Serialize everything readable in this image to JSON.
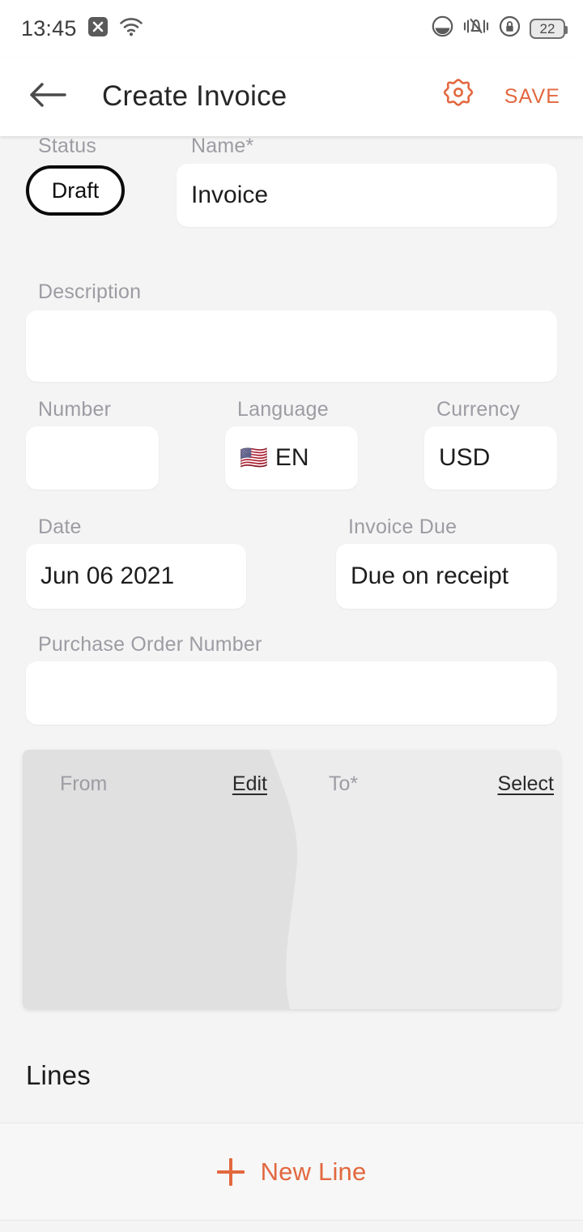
{
  "status_bar": {
    "time": "13:45",
    "icons": [
      "x-app-icon",
      "wifi-icon",
      "theme-circle-icon",
      "vibrate-bell-icon",
      "rotation-lock-icon"
    ],
    "battery_level": "22"
  },
  "app_bar": {
    "back_icon": "back-arrow-icon",
    "title": "Create Invoice",
    "settings_icon": "gear-icon",
    "save_label": "SAVE",
    "accent_color": "#e2683f"
  },
  "form": {
    "status": {
      "label": "Status",
      "value": "Draft"
    },
    "name": {
      "label": "Name*",
      "value": "Invoice",
      "placeholder": ""
    },
    "description": {
      "label": "Description",
      "value": "",
      "placeholder": ""
    },
    "number": {
      "label": "Number",
      "value": "",
      "placeholder": ""
    },
    "language": {
      "label": "Language",
      "flag": "🇺🇸",
      "value": "EN"
    },
    "currency": {
      "label": "Currency",
      "value": "USD"
    },
    "date": {
      "label": "Date",
      "value": "Jun 06 2021"
    },
    "invoice_due": {
      "label": "Invoice Due",
      "value": "Due on receipt"
    },
    "purchase_order_number": {
      "label": "Purchase Order Number",
      "value": "",
      "placeholder": ""
    }
  },
  "party_card": {
    "from": {
      "label": "From",
      "action": "Edit",
      "value": ""
    },
    "to": {
      "label": "To*",
      "action": "Select",
      "value": ""
    }
  },
  "lines": {
    "title": "Lines",
    "new_line_label": "New Line",
    "new_line_icon": "plus-icon"
  }
}
